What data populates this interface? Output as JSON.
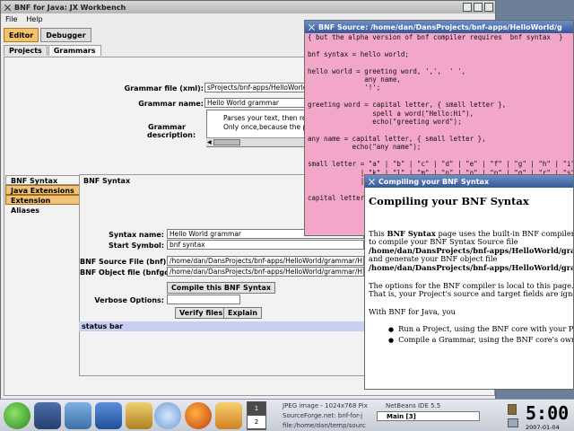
{
  "main_window": {
    "title": "BNF for Java: JX Workbench",
    "menu": [
      "File",
      "Help"
    ],
    "toolbar": [
      "Editor",
      "Debugger"
    ],
    "tabs": [
      "Projects",
      "Grammars"
    ],
    "grammar_file_label": "Grammar file (xml):",
    "grammar_file_value": "sProjects/bnf-apps/HelloWorld/g",
    "grammar_name_label": "Grammar name:",
    "grammar_name_value": "Hello World grammar",
    "grammar_desc_label1": "Grammar",
    "grammar_desc_label2": "description:",
    "grammar_desc_line1": "Parses your text, then rep",
    "grammar_desc_line2": "Only once,because the pa",
    "side_tabs": [
      "BNF Syntax",
      "Java Extensions",
      "Extension Aliases"
    ],
    "panel_title": "BNF Syntax",
    "syntax_name_label": "Syntax name:",
    "syntax_name_value": "Hello World grammar",
    "start_symbol_label": "Start Symbol:",
    "start_symbol_value": "bnf syntax",
    "bnf_source_label": "BNF Source File (bnf):",
    "bnf_source_value": "/home/dan/DansProjects/bnf-apps/HelloWorld/grammar/H",
    "bnf_object_label": "BNF Object file (bnfgo):",
    "bnf_object_value": "/home/dan/DansProjects/bnf-apps/HelloWorld/grammar/H",
    "compile_button": "Compile this BNF Syntax",
    "verbose_label": "Verbose Options:",
    "verbose_value": "",
    "verify_button": "Verify files",
    "explain_button": "Explain",
    "status_bar": "status bar"
  },
  "source_window": {
    "title": "BNF Source: /home/dan/DansProjects/bnf-apps/HelloWorld/g",
    "code": "{ but the alpha version of bnf compiler requires  bnf syntax  }\n\nbnf syntax = hello world;\n\nhello world = greeting word, ',',  ' ',\n              any name,\n              '!';\n\ngreeting word = capital letter, { small letter },\n                spell a word(\"Hello:Hi\"),\n                echo(\"greeting word\");\n\nany name = capital letter, { small letter },\n           echo(\"any name\");\n\nsmall letter = \"a\" | \"b\" | \"c\" | \"d\" | \"e\" | \"f\" | \"g\" | \"h\" | \"i\" |\n             | \"k\" | \"l\" | \"m\" | \"n\" | \"o\" | \"p\" | \"q\" | \"r\" | \"s\" |\n             |\n\ncapital letter"
  },
  "compile_window": {
    "title": "Compiling your BNF Syntax",
    "heading": "Compiling your BNF Syntax",
    "p1_a": "This ",
    "p1_b": "BNF Syntax",
    "p1_c": " page uses the built-in BNF compiler",
    "p1_d": "to compile your BNF Syntax Source file",
    "p1_e": "/home/dan/DansProjects/bnf-apps/HelloWorld/gra",
    "p1_f": "and generate your BNF object file",
    "p1_g": "/home/dan/DansProjects/bnf-apps/HelloWorld/gra",
    "p2_a": "The options for the BNF compiler is local to this page.",
    "p2_b": "That is, your Project's source and target fields are ignor",
    "p3": "With BNF for Java, you",
    "bullets": [
      "Run a Project, using the BNF core with your Proj",
      "Compile a Grammar, using the BNF core's own b"
    ]
  },
  "taskbar": {
    "pager": [
      "1",
      "2"
    ],
    "tasks": [
      "JPEG image - 1024x768 Pix",
      "SourceForge.net: bnf-for-j",
      "file:/home/dan/temp/sourc",
      "NetBeans IDE 5.5",
      "Main [3]"
    ],
    "clock": "5:00",
    "date": "2007-01-04"
  }
}
